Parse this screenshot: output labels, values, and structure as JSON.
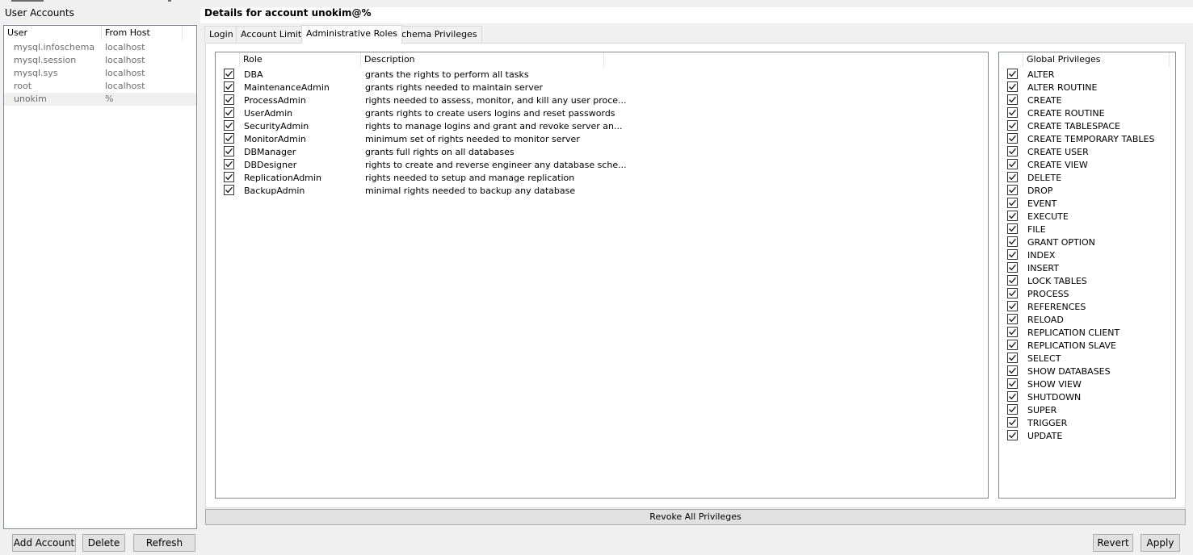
{
  "left": {
    "title": "User Accounts",
    "columns": [
      "User",
      "From Host"
    ],
    "accounts": [
      {
        "user": "mysql.infoschema",
        "host": "localhost"
      },
      {
        "user": "mysql.session",
        "host": "localhost"
      },
      {
        "user": "mysql.sys",
        "host": "localhost"
      },
      {
        "user": "root",
        "host": "localhost"
      },
      {
        "user": "unokim",
        "host": "%"
      }
    ],
    "buttons": {
      "add": "Add Account",
      "delete": "Delete",
      "refresh": "Refresh"
    }
  },
  "details": {
    "title": "Details for account unokim@%",
    "tabs": [
      "Login",
      "Account Limits",
      "Administrative Roles",
      "Schema Privileges"
    ],
    "active_tab": "Administrative Roles",
    "roles_columns": [
      "Role",
      "Description"
    ],
    "roles": [
      {
        "name": "DBA",
        "description": "grants the rights to perform all tasks",
        "checked": true
      },
      {
        "name": "MaintenanceAdmin",
        "description": "grants rights needed to maintain server",
        "checked": true
      },
      {
        "name": "ProcessAdmin",
        "description": "rights needed to assess, monitor, and kill any user proce...",
        "checked": true
      },
      {
        "name": "UserAdmin",
        "description": "grants rights to create users logins and reset passwords",
        "checked": true
      },
      {
        "name": "SecurityAdmin",
        "description": "rights to manage logins and grant and revoke server an...",
        "checked": true
      },
      {
        "name": "MonitorAdmin",
        "description": "minimum set of rights needed to monitor server",
        "checked": true
      },
      {
        "name": "DBManager",
        "description": "grants full rights on all databases",
        "checked": true
      },
      {
        "name": "DBDesigner",
        "description": "rights to create and reverse engineer any database sche...",
        "checked": true
      },
      {
        "name": "ReplicationAdmin",
        "description": "rights needed to setup and manage replication",
        "checked": true
      },
      {
        "name": "BackupAdmin",
        "description": "minimal rights needed to backup any database",
        "checked": true
      }
    ],
    "privileges_header": "Global Privileges",
    "privileges": [
      "ALTER",
      "ALTER ROUTINE",
      "CREATE",
      "CREATE ROUTINE",
      "CREATE TABLESPACE",
      "CREATE TEMPORARY TABLES",
      "CREATE USER",
      "CREATE VIEW",
      "DELETE",
      "DROP",
      "EVENT",
      "EXECUTE",
      "FILE",
      "GRANT OPTION",
      "INDEX",
      "INSERT",
      "LOCK TABLES",
      "PROCESS",
      "REFERENCES",
      "RELOAD",
      "REPLICATION CLIENT",
      "REPLICATION SLAVE",
      "SELECT",
      "SHOW DATABASES",
      "SHOW VIEW",
      "SHUTDOWN",
      "SUPER",
      "TRIGGER",
      "UPDATE"
    ],
    "revoke_label": "Revoke All Privileges",
    "revert_label": "Revert",
    "apply_label": "Apply"
  }
}
